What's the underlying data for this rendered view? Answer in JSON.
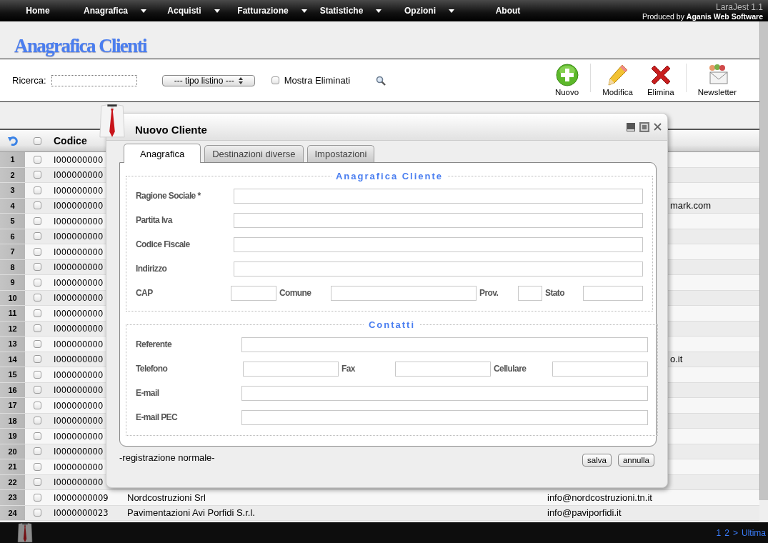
{
  "nav": {
    "items": [
      {
        "label": "Home",
        "has_menu": false
      },
      {
        "label": "Anagrafica",
        "has_menu": true
      },
      {
        "label": "Acquisti",
        "has_menu": true
      },
      {
        "label": "Fatturazione",
        "has_menu": true
      },
      {
        "label": "Statistiche",
        "has_menu": true
      },
      {
        "label": "Opzioni",
        "has_menu": true
      },
      {
        "label": "About",
        "has_menu": false
      }
    ],
    "app_name": "LaraJest 1.1",
    "credit": "Produced by **Aganis Web Software**"
  },
  "page_title": "Anagrafica Clienti",
  "toolbar": {
    "search_label": "Ricerca:",
    "listino_select": "--- tipo listino ---",
    "show_deleted": {
      "label": "Mostra Eliminati",
      "checked": false
    },
    "actions": [
      {
        "label": "Nuovo",
        "kind": "add"
      },
      {
        "label": "Modifica",
        "kind": "edit"
      },
      {
        "label": "Elimina",
        "kind": "delete"
      },
      {
        "label": "Newsletter",
        "kind": "newsletter"
      }
    ]
  },
  "table": {
    "columns": [
      "Codice"
    ],
    "all_checked": false,
    "rows": [
      {
        "num": "1",
        "code": "I000000000",
        "checked": false
      },
      {
        "num": "2",
        "code": "I000000000",
        "checked": false
      },
      {
        "num": "3",
        "code": "I000000000",
        "checked": false
      },
      {
        "num": "4",
        "code": "I000000000",
        "checked": false,
        "email_tail": "mark.com"
      },
      {
        "num": "5",
        "code": "I000000000",
        "checked": false
      },
      {
        "num": "6",
        "code": "I000000000",
        "checked": false
      },
      {
        "num": "7",
        "code": "I000000000",
        "checked": false
      },
      {
        "num": "8",
        "code": "I000000000",
        "checked": false
      },
      {
        "num": "9",
        "code": "I000000000",
        "checked": false
      },
      {
        "num": "10",
        "code": "I000000000",
        "checked": false
      },
      {
        "num": "11",
        "code": "I000000000",
        "checked": false
      },
      {
        "num": "12",
        "code": "I000000000",
        "checked": false
      },
      {
        "num": "13",
        "code": "I000000000",
        "checked": false
      },
      {
        "num": "14",
        "code": "I000000000",
        "checked": false,
        "email_tail": "o.it"
      },
      {
        "num": "15",
        "code": "I000000000",
        "checked": false
      },
      {
        "num": "16",
        "code": "I000000000",
        "checked": false
      },
      {
        "num": "17",
        "code": "I000000000",
        "checked": false
      },
      {
        "num": "18",
        "code": "I000000000",
        "checked": false
      },
      {
        "num": "19",
        "code": "I000000000",
        "checked": false
      },
      {
        "num": "20",
        "code": "I000000000",
        "checked": false
      },
      {
        "num": "21",
        "code": "I000000000",
        "checked": false
      },
      {
        "num": "22",
        "code": "I000000000",
        "checked": false
      },
      {
        "num": "23",
        "code": "I0000000009",
        "checked": false,
        "name": "Nordcostruzioni Srl",
        "email": "info@nordcostruzioni.tn.it"
      },
      {
        "num": "24",
        "code": "I0000000023",
        "checked": false,
        "name": "Pavimentazioni Avi Porfidi S.r.l.",
        "email": "info@paviporfidi.it"
      }
    ]
  },
  "pager": [
    "1",
    "2",
    ">",
    "Ultima"
  ],
  "dialog": {
    "title": "Nuovo Cliente",
    "tabs": [
      {
        "label": "Anagrafica",
        "selected": true
      },
      {
        "label": "Destinazioni diverse",
        "selected": false
      },
      {
        "label": "Impostazioni",
        "selected": false
      }
    ],
    "sections": [
      {
        "legend": "Anagrafica Cliente",
        "rows": [
          [
            {
              "label": "Ragione Sociale *"
            }
          ],
          [
            {
              "label": "Partita Iva"
            }
          ],
          [
            {
              "label": "Codice Fiscale"
            }
          ],
          [
            {
              "label": "Indirizzo"
            }
          ],
          [
            {
              "label": "CAP"
            },
            {
              "label": "Comune"
            },
            {
              "label": "Prov."
            },
            {
              "label": "Stato"
            }
          ]
        ]
      },
      {
        "legend": "Contatti",
        "rows": [
          [
            {
              "label": "Referente"
            }
          ],
          [
            {
              "label": "Telefono"
            },
            {
              "label": "Fax"
            },
            {
              "label": "Cellulare"
            }
          ],
          [
            {
              "label": "E-mail"
            }
          ],
          [
            {
              "label": "E-mail PEC"
            }
          ]
        ]
      }
    ],
    "status": "-registrazione normale-",
    "buttons": [
      "salva",
      "annulla"
    ]
  }
}
